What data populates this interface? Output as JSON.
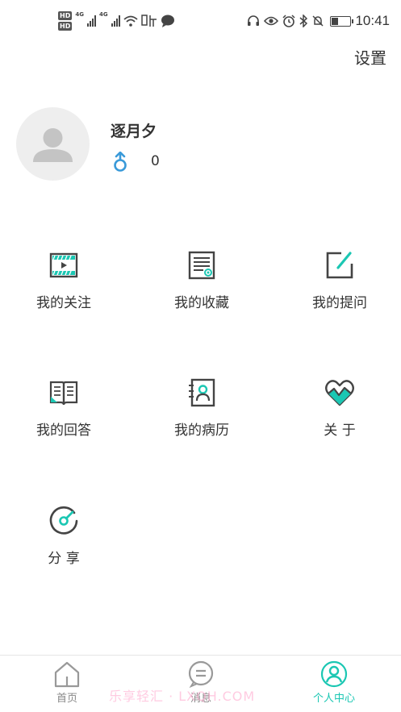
{
  "status_bar": {
    "hd1": "HD",
    "hd2": "HD",
    "net1": "4G",
    "net2": "4G",
    "time": "10:41"
  },
  "header": {
    "settings_label": "设置"
  },
  "profile": {
    "name": "逐月夕",
    "count": "0"
  },
  "menu": {
    "items": [
      {
        "label": "我的关注"
      },
      {
        "label": "我的收藏"
      },
      {
        "label": "我的提问"
      },
      {
        "label": "我的回答"
      },
      {
        "label": "我的病历"
      },
      {
        "label": "关 于"
      },
      {
        "label": "分 享"
      }
    ]
  },
  "bottom_nav": {
    "items": [
      {
        "label": "首页"
      },
      {
        "label": "消息"
      },
      {
        "label": "个人中心"
      }
    ]
  },
  "watermark": "乐享轻汇 · LXQH.COM",
  "colors": {
    "accent": "#1bc7b3",
    "icon_dark": "#444444",
    "gender_blue": "#3a9ad9"
  }
}
